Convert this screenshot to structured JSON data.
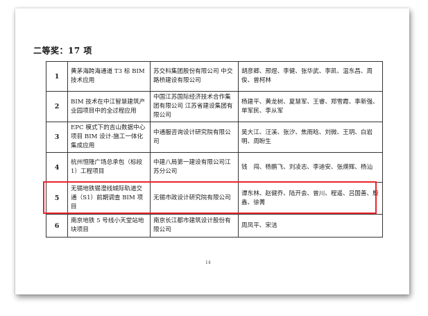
{
  "section": {
    "title": "二等奖：17 项"
  },
  "rows": [
    {
      "num": "1",
      "project": "黄茅海跨海通道 T3 标 BIM 技术应用",
      "org": "苏交科集团股份有限公司 中交路桥建设有限公司",
      "people": "胡彦卿、邢煜、李健、张华武、李凯、温东昌、周俊、曾柯林"
    },
    {
      "num": "2",
      "project": "BIM 技术在中江智慧建筑产业园项目中的全过程应用",
      "org": "中国江苏国际经济技术合作集团有限公司 江苏省建设集团有限公司",
      "people": "杨建平、黄龙树、夏慧军、王睿、郑雪霞、季新强、单军民、李从军"
    },
    {
      "num": "3",
      "project": "EPC 模式下的吉山数据中心项目 BIM 设计-施工一体化集成应用",
      "org": "中通服咨询设计研究院有限公司",
      "people": "吴大江、汪溪、张汐、焦雨晗、刘微、王玥、白岩明、周盼生"
    },
    {
      "num": "4",
      "project": "杭州恒隆广场总承包（标段 1）工程项目",
      "org": "中建八局第一建设有限公司江苏分公司",
      "people": "钱　闯、杨鹏飞、刘凌志、李迪安、张煐辉、杨汕"
    },
    {
      "num": "5",
      "project": "无锡地铁锡澄线城际轨道交通（S1）前期调查 BIM 项目",
      "org": "无锡市政设计研究院有限公司",
      "people": "谭东林、赵健乔、陆开会、曾川、程遥、吕国善、殷鑫、徐菁"
    },
    {
      "num": "6",
      "project": "南京地铁 5 号线小天堂站地块项目",
      "org": "南京长江都市建筑设计股份有限公司",
      "people": "周凤平、宋洁"
    }
  ],
  "footer": {
    "page_number": "14"
  }
}
